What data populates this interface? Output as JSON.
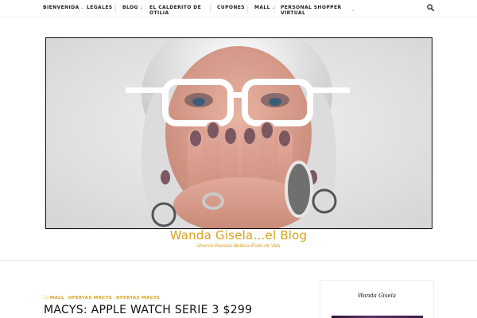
{
  "nav": {
    "items": [
      {
        "label": "BIENVENIDA",
        "has_dropdown": true
      },
      {
        "label": "LEGALES",
        "has_dropdown": true
      },
      {
        "label": "BLOG",
        "has_dropdown": true
      },
      {
        "label_line1": "EL CALDERITO DE",
        "label_line2": "OTILIA",
        "has_dropdown": false
      },
      {
        "label": "CUPONES",
        "has_dropdown": true
      },
      {
        "label": "MALL",
        "has_dropdown": true
      },
      {
        "label_line1": "PERSONAL SHOPPER",
        "label_line2": "VIRTUAL",
        "has_dropdown": true
      }
    ],
    "search_icon": "search-icon"
  },
  "header": {
    "site_title": "Wanda Gisela…el Blog",
    "tagline": "Ahorros-Recetas-Belleza-Estilo de Vida"
  },
  "post": {
    "categories": [
      "MALL",
      "OFERTAS MACYS",
      "OFERTAS MACYS"
    ],
    "category_icon": "folder-icon",
    "title": "MACYS: APPLE WATCH SERIE 3 $299"
  },
  "sidebar": {
    "widget_title": "Wanda Gisela"
  },
  "colors": {
    "accent": "#d9a21b",
    "text": "#222222",
    "border": "#eeeeee"
  }
}
